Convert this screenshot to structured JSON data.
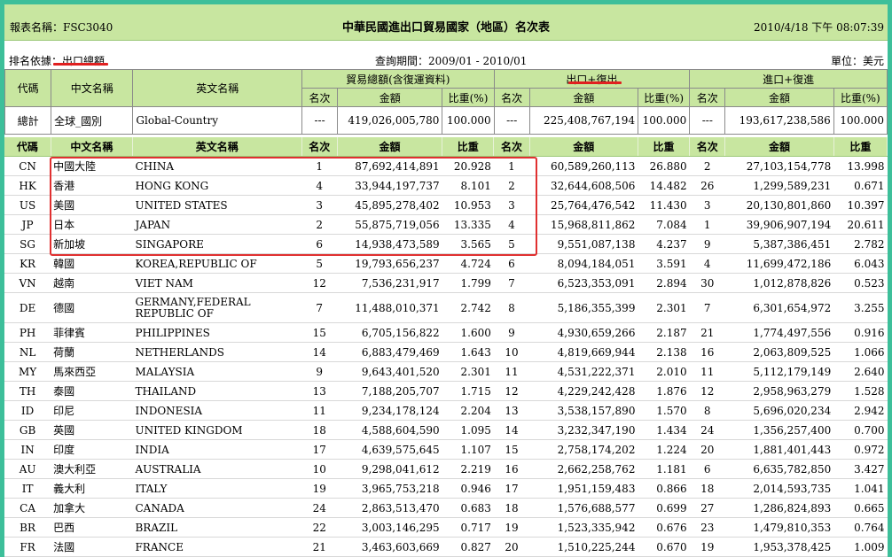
{
  "header": {
    "report_id": "報表名稱：FSC3040",
    "title": "中華民國進出口貿易國家（地區）名次表",
    "timestamp": "2010/4/18 下午 08:07:39"
  },
  "info": {
    "rank_basis_label": "排名依據：",
    "rank_basis_value": "出口總額",
    "period_label": "查詢期間：",
    "period_value": "2009/01 - 2010/01",
    "unit_label": "單位：",
    "unit_value": "美元"
  },
  "summary": {
    "h_code": "代碼",
    "h_cname": "中文名稱",
    "h_ename": "英文名稱",
    "g1": "貿易總額(含復運資料)",
    "g2": "出口+復出",
    "g3": "進口+復進",
    "h_rank": "名次",
    "h_amount": "金額",
    "h_share": "比重(%)",
    "row": {
      "label": "總計",
      "cname": "全球_國別",
      "ename": "Global-Country",
      "r1": "---",
      "a1": "419,026,005,780",
      "s1": "100.000",
      "r2": "---",
      "a2": "225,408,767,194",
      "s2": "100.000",
      "r3": "---",
      "a3": "193,617,238,586",
      "s3": "100.000"
    }
  },
  "table": {
    "headers": [
      "代碼",
      "中文名稱",
      "英文名稱",
      "名次",
      "金額",
      "比重",
      "名次",
      "金額",
      "比重",
      "名次",
      "金額",
      "比重"
    ],
    "rows": [
      [
        "CN",
        "中國大陸",
        "CHINA",
        "1",
        "87,692,414,891",
        "20.928",
        "1",
        "60,589,260,113",
        "26.880",
        "2",
        "27,103,154,778",
        "13.998"
      ],
      [
        "HK",
        "香港",
        "HONG KONG",
        "4",
        "33,944,197,737",
        "8.101",
        "2",
        "32,644,608,506",
        "14.482",
        "26",
        "1,299,589,231",
        "0.671"
      ],
      [
        "US",
        "美國",
        "UNITED STATES",
        "3",
        "45,895,278,402",
        "10.953",
        "3",
        "25,764,476,542",
        "11.430",
        "3",
        "20,130,801,860",
        "10.397"
      ],
      [
        "JP",
        "日本",
        "JAPAN",
        "2",
        "55,875,719,056",
        "13.335",
        "4",
        "15,968,811,862",
        "7.084",
        "1",
        "39,906,907,194",
        "20.611"
      ],
      [
        "SG",
        "新加坡",
        "SINGAPORE",
        "6",
        "14,938,473,589",
        "3.565",
        "5",
        "9,551,087,138",
        "4.237",
        "9",
        "5,387,386,451",
        "2.782"
      ],
      [
        "KR",
        "韓國",
        "KOREA,REPUBLIC OF",
        "5",
        "19,793,656,237",
        "4.724",
        "6",
        "8,094,184,051",
        "3.591",
        "4",
        "11,699,472,186",
        "6.043"
      ],
      [
        "VN",
        "越南",
        "VIET NAM",
        "12",
        "7,536,231,917",
        "1.799",
        "7",
        "6,523,353,091",
        "2.894",
        "30",
        "1,012,878,826",
        "0.523"
      ],
      [
        "DE",
        "德國",
        "GERMANY,FEDERAL REPUBLIC OF",
        "7",
        "11,488,010,371",
        "2.742",
        "8",
        "5,186,355,399",
        "2.301",
        "7",
        "6,301,654,972",
        "3.255"
      ],
      [
        "PH",
        "菲律賓",
        "PHILIPPINES",
        "15",
        "6,705,156,822",
        "1.600",
        "9",
        "4,930,659,266",
        "2.187",
        "21",
        "1,774,497,556",
        "0.916"
      ],
      [
        "NL",
        "荷蘭",
        "NETHERLANDS",
        "14",
        "6,883,479,469",
        "1.643",
        "10",
        "4,819,669,944",
        "2.138",
        "16",
        "2,063,809,525",
        "1.066"
      ],
      [
        "MY",
        "馬來西亞",
        "MALAYSIA",
        "9",
        "9,643,401,520",
        "2.301",
        "11",
        "4,531,222,371",
        "2.010",
        "11",
        "5,112,179,149",
        "2.640"
      ],
      [
        "TH",
        "泰國",
        "THAILAND",
        "13",
        "7,188,205,707",
        "1.715",
        "12",
        "4,229,242,428",
        "1.876",
        "12",
        "2,958,963,279",
        "1.528"
      ],
      [
        "ID",
        "印尼",
        "INDONESIA",
        "11",
        "9,234,178,124",
        "2.204",
        "13",
        "3,538,157,890",
        "1.570",
        "8",
        "5,696,020,234",
        "2.942"
      ],
      [
        "GB",
        "英國",
        "UNITED KINGDOM",
        "18",
        "4,588,604,590",
        "1.095",
        "14",
        "3,232,347,190",
        "1.434",
        "24",
        "1,356,257,400",
        "0.700"
      ],
      [
        "IN",
        "印度",
        "INDIA",
        "17",
        "4,639,575,645",
        "1.107",
        "15",
        "2,758,174,202",
        "1.224",
        "20",
        "1,881,401,443",
        "0.972"
      ],
      [
        "AU",
        "澳大利亞",
        "AUSTRALIA",
        "10",
        "9,298,041,612",
        "2.219",
        "16",
        "2,662,258,762",
        "1.181",
        "6",
        "6,635,782,850",
        "3.427"
      ],
      [
        "IT",
        "義大利",
        "ITALY",
        "19",
        "3,965,753,218",
        "0.946",
        "17",
        "1,951,159,483",
        "0.866",
        "18",
        "2,014,593,735",
        "1.041"
      ],
      [
        "CA",
        "加拿大",
        "CANADA",
        "24",
        "2,863,513,470",
        "0.683",
        "18",
        "1,576,688,577",
        "0.699",
        "27",
        "1,286,824,893",
        "0.665"
      ],
      [
        "BR",
        "巴西",
        "BRAZIL",
        "22",
        "3,003,146,295",
        "0.717",
        "19",
        "1,523,335,942",
        "0.676",
        "23",
        "1,479,810,353",
        "0.764"
      ],
      [
        "FR",
        "法國",
        "FRANCE",
        "21",
        "3,463,603,669",
        "0.827",
        "20",
        "1,510,225,244",
        "0.670",
        "19",
        "1,953,378,425",
        "1.009"
      ]
    ]
  },
  "highlight_count": 5
}
